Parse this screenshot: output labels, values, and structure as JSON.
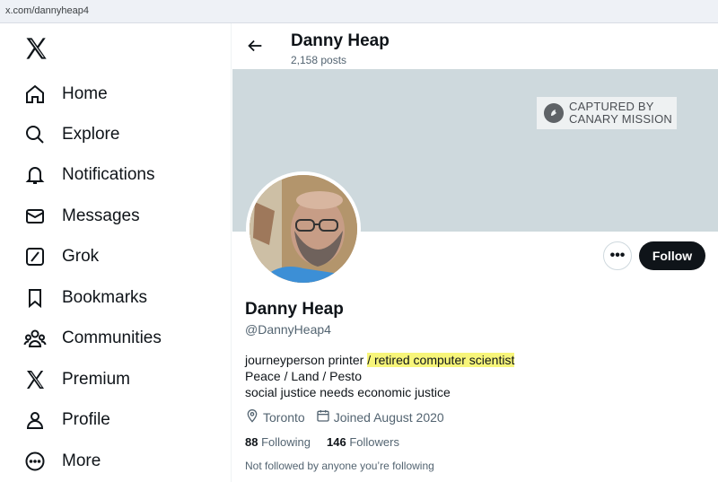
{
  "browser": {
    "url": "x.com/dannyheap4"
  },
  "sidebar": {
    "logo": "x-logo",
    "items": [
      {
        "label": "Home",
        "icon": "home-icon"
      },
      {
        "label": "Explore",
        "icon": "search-icon"
      },
      {
        "label": "Notifications",
        "icon": "bell-icon"
      },
      {
        "label": "Messages",
        "icon": "envelope-icon"
      },
      {
        "label": "Grok",
        "icon": "grok-icon"
      },
      {
        "label": "Bookmarks",
        "icon": "bookmark-icon"
      },
      {
        "label": "Communities",
        "icon": "communities-icon"
      },
      {
        "label": "Premium",
        "icon": "x-icon"
      },
      {
        "label": "Profile",
        "icon": "person-icon"
      },
      {
        "label": "More",
        "icon": "more-circle-icon"
      }
    ]
  },
  "header": {
    "name": "Danny Heap",
    "posts": "2,158 posts"
  },
  "banner": {
    "stamp_line1": "CAPTURED BY",
    "stamp_line2": "CANARY MISSION",
    "color": "#ced9dd"
  },
  "profile": {
    "name": "Danny Heap",
    "handle": "@DannyHeap4",
    "bio_line1_a": "journeyperson printer ",
    "bio_line1_b": "/ retired computer scientist",
    "bio_line2": "Peace / Land / Pesto",
    "bio_line3": "social justice needs economic justice",
    "location": "Toronto",
    "joined": "Joined August 2020",
    "following_count": "88",
    "following_label": "Following",
    "followers_count": "146",
    "followers_label": "Followers",
    "not_followed": "Not followed by anyone you’re following"
  },
  "actions": {
    "more_label": "•••",
    "follow_label": "Follow"
  },
  "colors": {
    "accent": "#0f1419",
    "highlight": "#f7f57a",
    "secondary_text": "#536471"
  }
}
